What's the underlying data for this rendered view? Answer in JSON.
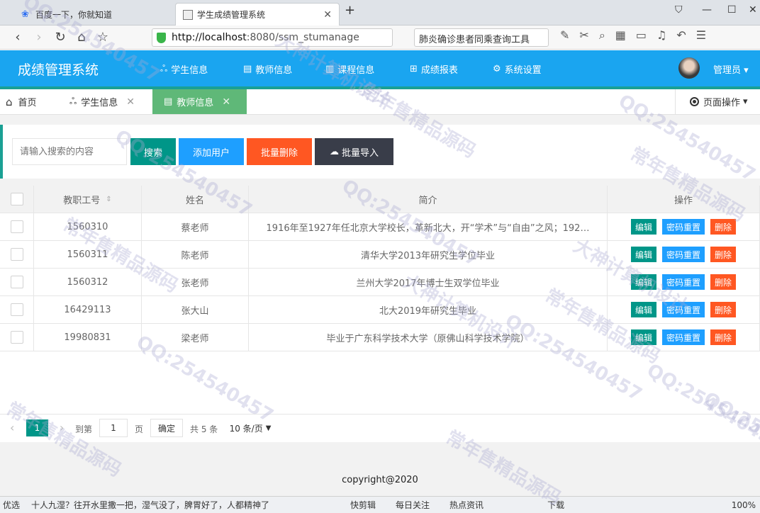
{
  "browser": {
    "tabs": [
      {
        "title": "百度一下，你就知道"
      },
      {
        "title": "学生成绩管理系统"
      }
    ],
    "new_tab": "+",
    "url_bold": "http://localhost",
    "url_rest": ":8080/ssm_stumanage",
    "search_text": "肺炎确诊患者同乘查询工具"
  },
  "app": {
    "title": "成绩管理系统",
    "menu": [
      {
        "label": "学生信息",
        "icon": "users-icon"
      },
      {
        "label": "教师信息",
        "icon": "clipboard-icon"
      },
      {
        "label": "课程信息",
        "icon": "book-icon"
      },
      {
        "label": "成绩报表",
        "icon": "grid-icon"
      },
      {
        "label": "系统设置",
        "icon": "gear-icon"
      }
    ],
    "user": "管理员"
  },
  "page_tabs": [
    {
      "label": "首页",
      "icon": "home-icon"
    },
    {
      "label": "学生信息",
      "icon": "users-icon"
    },
    {
      "label": "教师信息",
      "icon": "clipboard-icon"
    }
  ],
  "page_ops": "页面操作",
  "toolbar": {
    "search_placeholder": "请输入搜索的内容",
    "search": "搜索",
    "add": "添加用户",
    "batch_delete": "批量删除",
    "batch_import": "批量导入"
  },
  "table": {
    "headers": [
      "教职工号",
      "姓名",
      "简介",
      "操作"
    ],
    "rows": [
      {
        "id": "1560310",
        "name": "蔡老师",
        "intro": "1916年至1927年任北京大学校长，革新北大，开“学术”与“自由”之风；192…"
      },
      {
        "id": "1560311",
        "name": "陈老师",
        "intro": "清华大学2013年研究生学位毕业"
      },
      {
        "id": "1560312",
        "name": "张老师",
        "intro": "兰州大学2017年博士生双学位毕业"
      },
      {
        "id": "16429113",
        "name": "张大山",
        "intro": "北大2019年研究生毕业"
      },
      {
        "id": "19980831",
        "name": "梁老师",
        "intro": "毕业于广东科学技术大学（原佛山科学技术学院）"
      }
    ],
    "actions": {
      "edit": "编辑",
      "reset": "密码重置",
      "delete": "删除"
    }
  },
  "pager": {
    "current": "1",
    "goto_label": "到第",
    "goto_value": "1",
    "page_unit": "页",
    "confirm": "确定",
    "total": "共 5 条",
    "per_page": "10 条/页"
  },
  "footer": "copyright@2020",
  "statusbar": {
    "left": "优选",
    "news": "十人九湿？往开水里撒一把，湿气没了，脾胃好了，人都精神了",
    "items": [
      "快剪辑",
      "每日关注",
      "热点资讯",
      "下载"
    ],
    "zoom": "100%"
  },
  "watermark": [
    "QQ:254540457",
    "大神计算机设计",
    "常年售精品源码"
  ],
  "colors": {
    "header": "#1aa5f0",
    "green": "#009688",
    "blue": "#1e9fff",
    "red": "#ff5722",
    "dark": "#393d49",
    "tab_active": "#5fb878"
  }
}
